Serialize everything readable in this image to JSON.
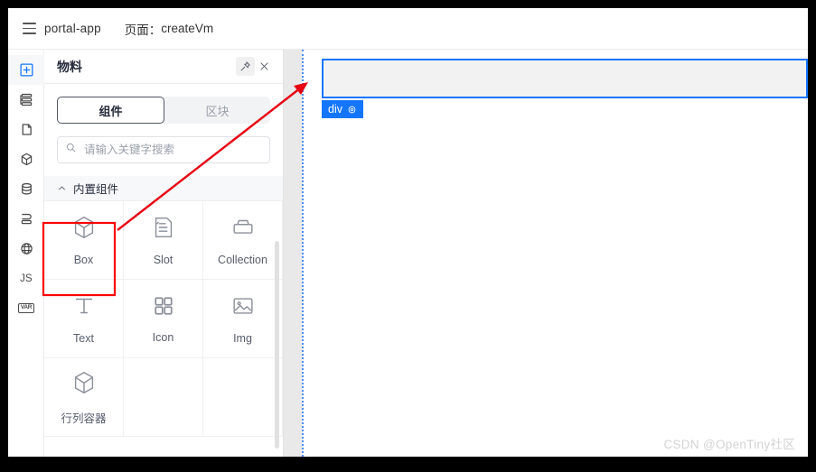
{
  "topbar": {
    "menu_icon": "hamburger-icon",
    "app_name": "portal-app",
    "page_label": "页面：",
    "page_value": "createVm"
  },
  "rail": {
    "items": [
      {
        "name": "add-component-icon",
        "label": "",
        "active": true
      },
      {
        "name": "layers-icon",
        "label": "",
        "active": false
      },
      {
        "name": "page-schema-icon",
        "label": "",
        "active": false
      },
      {
        "name": "block-cube-icon",
        "label": "",
        "active": false
      },
      {
        "name": "data-source-icon",
        "label": "",
        "active": false
      },
      {
        "name": "tray-icon",
        "label": "",
        "active": false
      },
      {
        "name": "i18n-globe-icon",
        "label": "",
        "active": false
      },
      {
        "name": "js-script-icon",
        "label": "JS",
        "active": false
      },
      {
        "name": "variable-icon",
        "label": "VAR",
        "active": false
      }
    ]
  },
  "panel": {
    "title": "物料",
    "pin_icon": "pin-icon",
    "close_icon": "close-icon",
    "tabs": [
      {
        "label": "组件",
        "active": true
      },
      {
        "label": "区块",
        "active": false
      }
    ],
    "search": {
      "icon": "search-icon",
      "placeholder": "请输入关键字搜索",
      "value": ""
    },
    "group": {
      "chevron_icon": "chevron-up-icon",
      "title": "内置组件"
    },
    "components": [
      {
        "label": "Box",
        "icon": "cube-icon",
        "highlighted": true
      },
      {
        "label": "Slot",
        "icon": "slot-icon",
        "highlighted": false
      },
      {
        "label": "Collection",
        "icon": "collection-icon",
        "highlighted": false
      },
      {
        "label": "Text",
        "icon": "text-icon",
        "highlighted": false
      },
      {
        "label": "Icon",
        "icon": "grid-icon",
        "highlighted": false
      },
      {
        "label": "Img",
        "icon": "image-icon",
        "highlighted": false
      },
      {
        "label": "行列容器",
        "icon": "cube-icon",
        "highlighted": false
      },
      {
        "label": "",
        "icon": "",
        "highlighted": false
      },
      {
        "label": "",
        "icon": "",
        "highlighted": false
      }
    ]
  },
  "canvas": {
    "node_badge": {
      "label": "div",
      "settings_icon": "gear-icon"
    }
  },
  "annotations": {
    "arrow_color": "#e60012",
    "highlight_color": "#ff0000"
  },
  "watermark": "CSDN @OpenTiny社区"
}
